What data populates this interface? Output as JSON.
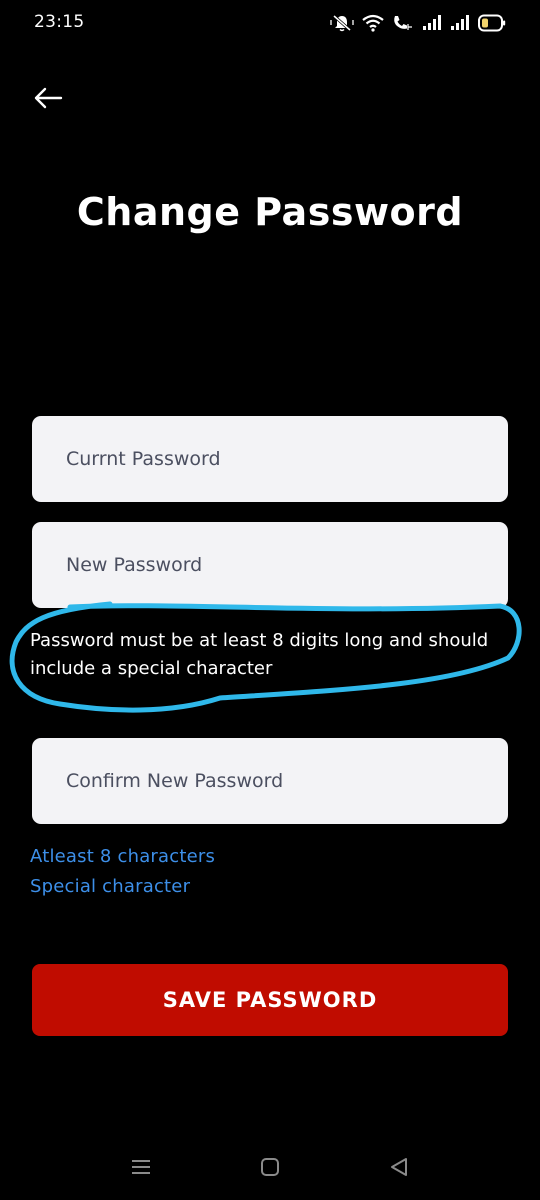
{
  "status_bar": {
    "time": "23:15",
    "icons": [
      "mute-icon",
      "wifi-icon",
      "volte-call-icon",
      "signal-icon",
      "signal-icon",
      "battery-icon"
    ]
  },
  "header": {
    "back_icon": "arrow-left-icon",
    "title": "Change Password"
  },
  "form": {
    "current_password": {
      "placeholder": "Currnt Password",
      "value": ""
    },
    "new_password": {
      "placeholder": "New Password",
      "value": ""
    },
    "hint": "Password must be at least 8 digits long and should include a special character",
    "confirm_password": {
      "placeholder": "Confirm New Password",
      "value": ""
    },
    "rules": {
      "length": "Atleast 8 characters",
      "special": "Special character"
    },
    "save_label": "SAVE PASSWORD"
  },
  "colors": {
    "background": "#000000",
    "field_background": "#f3f3f6",
    "rule_text": "#3d8fe8",
    "save_button": "#c00c00",
    "annotation_outline": "#2fb8ea"
  },
  "system_nav": {
    "icons": [
      "menu-icon",
      "home-icon",
      "back-triangle-icon"
    ]
  }
}
